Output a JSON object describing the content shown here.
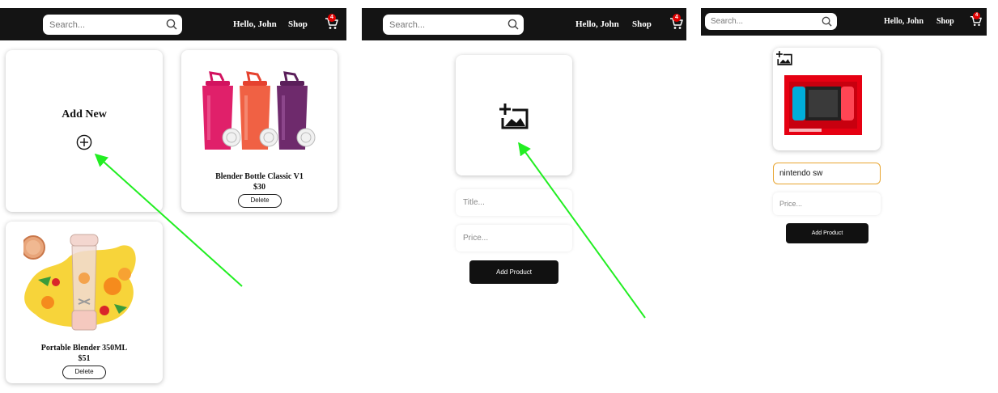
{
  "navbar": {
    "search_placeholder": "Search...",
    "greeting": "Hello, John",
    "shop_label": "Shop",
    "cart_count": "4"
  },
  "panel1": {
    "add_new": {
      "label": "Add New"
    },
    "products": [
      {
        "title": "Blender Bottle Classic V1",
        "price": "$30",
        "delete_label": "Delete"
      },
      {
        "title": "Portable Blender 350ML",
        "price": "$51",
        "delete_label": "Delete"
      }
    ]
  },
  "panel2": {
    "title_placeholder": "Title...",
    "price_placeholder": "Price...",
    "submit_label": "Add Product"
  },
  "panel3": {
    "title_value": "nintendo sw",
    "price_placeholder": "Price...",
    "submit_label": "Add Product"
  },
  "colors": {
    "navbar": "#141414",
    "badge": "#e00000",
    "arrow": "#22ee22",
    "focus_border": "#e8a530"
  },
  "icons": [
    "search-icon",
    "cart-icon",
    "plus-circle-icon",
    "add-image-icon"
  ]
}
